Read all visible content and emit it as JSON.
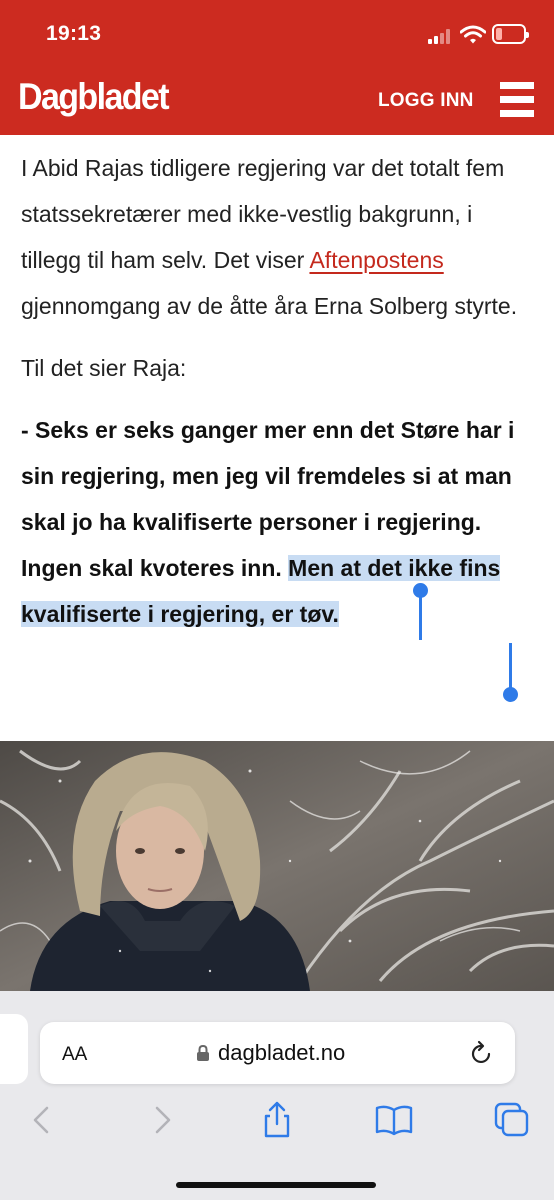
{
  "status_bar": {
    "time": "19:13",
    "battery_color": "#ffb0a8"
  },
  "header": {
    "brand": "Dagbladet",
    "login_label": "LOGG INN",
    "menu_icon": "hamburger-icon",
    "background_color": "#cc2b20"
  },
  "article": {
    "para1_before_link": "I Abid Rajas tidligere regjering var det totalt fem statssekretærer med ikke-vestlig bakgrunn, i tillegg til ham selv. Det viser ",
    "para1_link": "Aftenpostens",
    "para1_after_link": " gjennomgang av de åtte åra Erna Solberg styrte.",
    "para2": "Til det sier Raja:",
    "quote_unselected": "- Seks er seks ganger mer enn det Støre har i sin regjering, men jeg vil fremdeles si at man skal jo ha kvalifiserte personer i regjering. Ingen skal kvoteres inn. ",
    "quote_selected": "Men at det ikke fins kvalifiserte i regjering, er tøv.",
    "link_color": "#c4291d",
    "selection_color": "#c8dcf3"
  },
  "photo": {
    "alt_subject": "woman-in-snow-photo"
  },
  "browser": {
    "aa_label": "AA",
    "url": "dagbladet.no",
    "icons": [
      "back-icon",
      "forward-icon",
      "share-icon",
      "bookmarks-icon",
      "tabs-icon"
    ],
    "accent_color": "#2f7be8"
  }
}
